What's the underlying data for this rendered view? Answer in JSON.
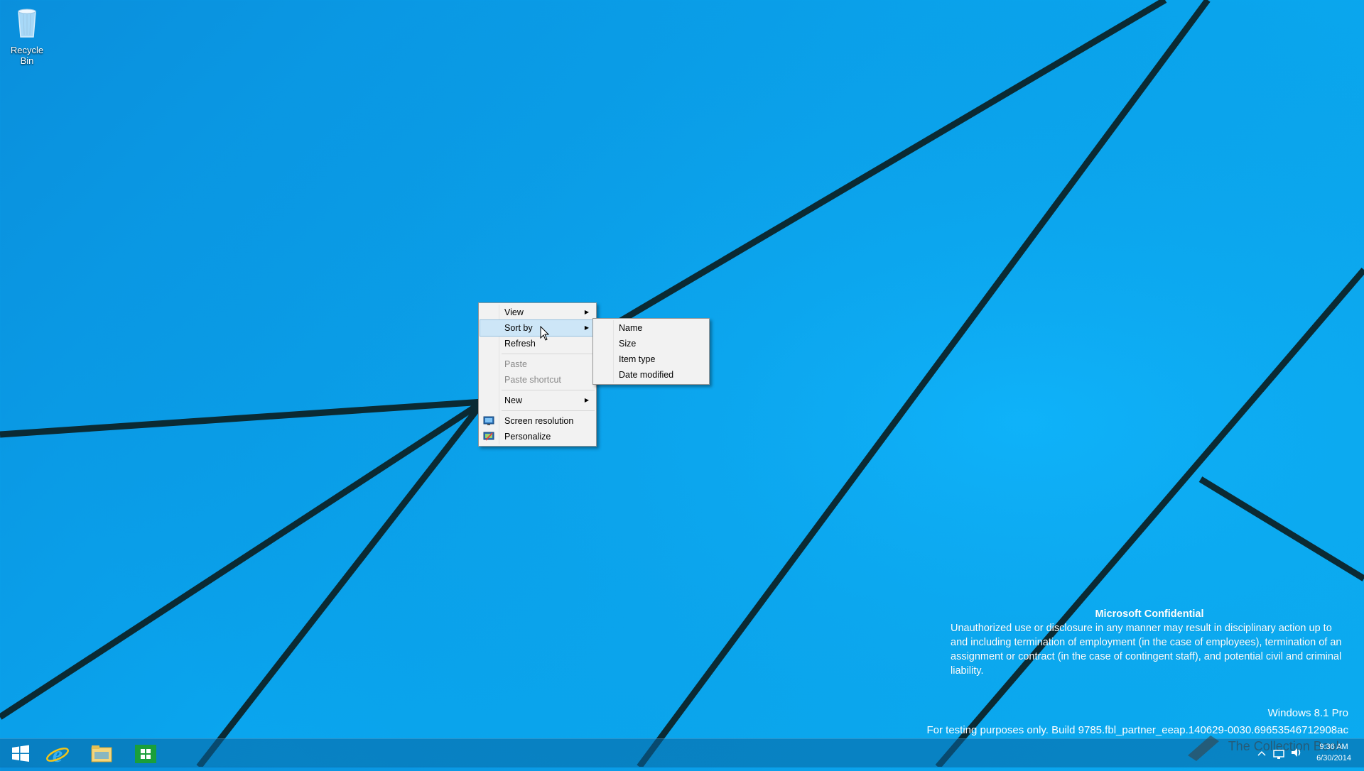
{
  "desktop": {
    "recycle_bin_label": "Recycle Bin"
  },
  "context_menu": {
    "items": [
      {
        "label": "View",
        "has_submenu": true
      },
      {
        "label": "Sort by",
        "has_submenu": true,
        "highlighted": true
      },
      {
        "label": "Refresh"
      },
      {
        "label": "Paste",
        "disabled": true
      },
      {
        "label": "Paste shortcut",
        "disabled": true
      },
      {
        "label": "New",
        "has_submenu": true
      },
      {
        "label": "Screen resolution",
        "icon": "monitor-icon"
      },
      {
        "label": "Personalize",
        "icon": "personalize-icon"
      }
    ]
  },
  "sort_submenu": {
    "items": [
      {
        "label": "Name"
      },
      {
        "label": "Size"
      },
      {
        "label": "Item type"
      },
      {
        "label": "Date modified"
      }
    ]
  },
  "watermark": {
    "title": "Microsoft Confidential",
    "body": "Unauthorized use or disclosure in any manner may result in disciplinary action up to and including termination of employment (in the case of employees), termination of an assignment or contract (in the case of contingent staff), and potential civil and criminal liability.",
    "edition": "Windows 8.1 Pro",
    "build": "For testing purposes only. Build 9785.fbl_partner_eeap.140629-0030.69653546712908ac"
  },
  "taskbar": {
    "apps": [
      "start-button",
      "internet-explorer-icon",
      "file-explorer-icon",
      "store-icon"
    ],
    "clock_time": "9:36 AM",
    "clock_date": "6/30/2014",
    "overlay_logo_text": "The Collection Book"
  },
  "colors": {
    "accent_blue": "#0aa5ee",
    "menu_bg": "#f2f2f2",
    "menu_hover": "#cde6f7"
  }
}
